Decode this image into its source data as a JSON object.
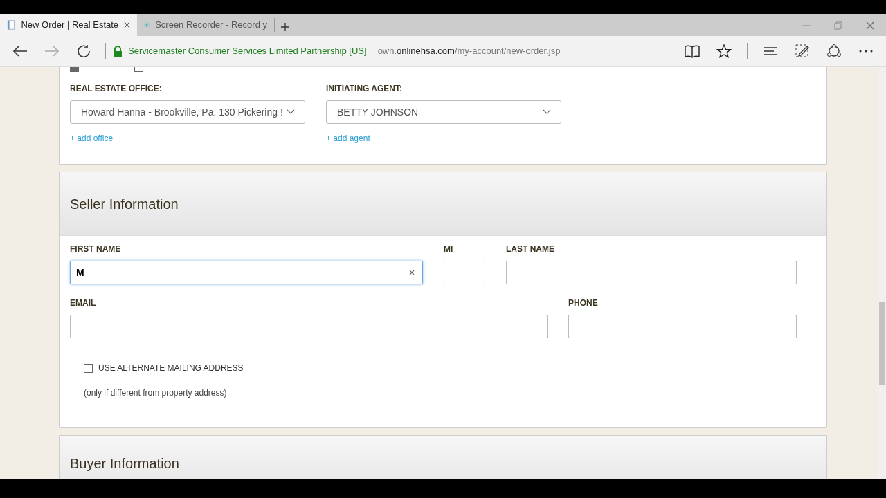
{
  "browser": {
    "tabs": [
      {
        "title": "New Order | Real Estate",
        "selected": true,
        "closable": true
      },
      {
        "title": "Screen Recorder - Record y",
        "selected": false,
        "closable": false
      }
    ],
    "security_label": "Servicemaster Consumer Services Limited Partnership [US]",
    "url_prefix": "own.",
    "url_domain": "onlinehsa.com",
    "url_path": "/my-account/new-order.jsp"
  },
  "role_checkboxes": [
    {
      "checked": true
    },
    {
      "checked": false
    }
  ],
  "office": {
    "label": "REAL ESTATE OFFICE:",
    "value": "Howard Hanna - Brookville, Pa, 130 Pickering !",
    "link": "+ add office"
  },
  "agent": {
    "label": "INITIATING AGENT:",
    "value": "BETTY JOHNSON",
    "link": "+ add agent"
  },
  "seller": {
    "title": "Seller Information",
    "first_name": {
      "label": "FIRST NAME",
      "value": "M",
      "focused": true
    },
    "mi": {
      "label": "MI"
    },
    "last_name": {
      "label": "LAST NAME"
    },
    "email": {
      "label": "EMAIL"
    },
    "phone": {
      "label": "PHONE"
    },
    "alt_address": {
      "label": "USE ALTERNATE MAILING ADDRESS",
      "checked": false,
      "note": "(only if different from property address)"
    }
  },
  "buyer": {
    "title": "Buyer Information"
  }
}
